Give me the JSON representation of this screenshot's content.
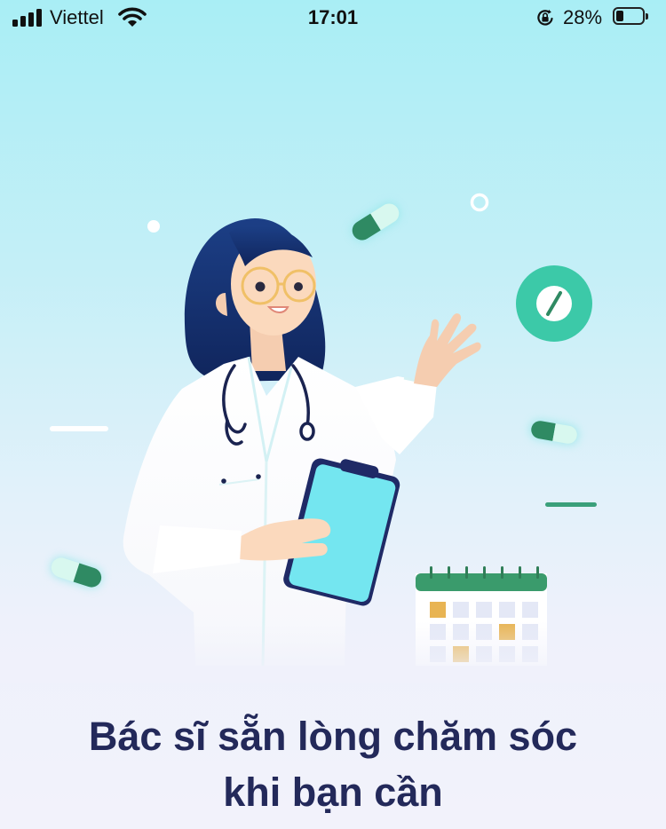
{
  "status_bar": {
    "carrier": "Viettel",
    "time": "17:01",
    "battery_percent": "28%",
    "battery_level": 0.28,
    "icons": [
      "cellular-signal-icon",
      "wifi-icon",
      "orientation-lock-icon",
      "battery-icon"
    ]
  },
  "onboarding": {
    "title_line1": "Bác sĩ sẵn lòng chăm sóc",
    "title_line2": "khi bạn cần",
    "illustration": "doctor-with-clipboard-illustration"
  },
  "colors": {
    "title_text": "#23295a",
    "background_top": "#a9eef5",
    "background_bottom": "#f2f2fb",
    "accent_teal": "#3cc9a8",
    "clipboard": "#74e6f0",
    "calendar_green": "#3a9b6c",
    "hair_navy": "#1a3a7c"
  }
}
